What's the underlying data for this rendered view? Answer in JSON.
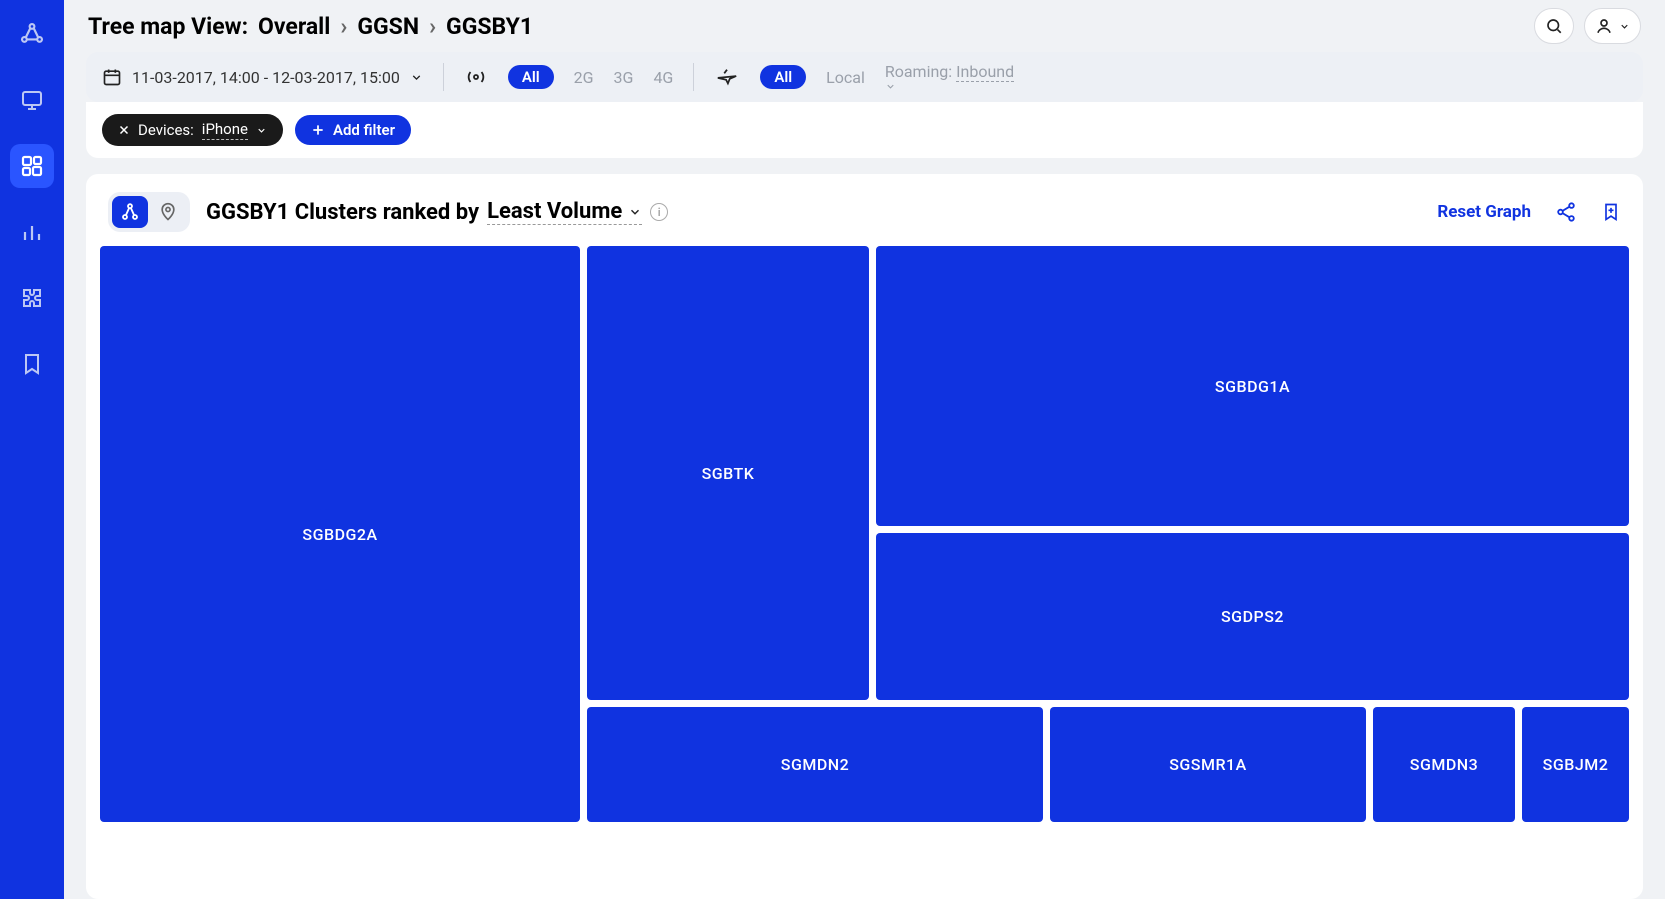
{
  "breadcrumb": {
    "prefix": "Tree map View:",
    "level0": "Overall",
    "level1": "GGSN",
    "level2": "GGSBY1"
  },
  "filters": {
    "date_range": "11-03-2017, 14:00 - 12-03-2017, 15:00",
    "radio": {
      "all": "All",
      "g2": "2G",
      "g3": "3G",
      "g4": "4G"
    },
    "roaming": {
      "all": "All",
      "local": "Local",
      "roaming_label": "Roaming:",
      "roaming_value": "Inbound"
    },
    "device_chip_label": "Devices:",
    "device_chip_value": "iPhone",
    "add_filter": "Add filter"
  },
  "card": {
    "title_prefix": "GGSBY1 Clusters ranked by",
    "rank_metric": "Least Volume",
    "reset": "Reset Graph"
  },
  "chart_data": {
    "type": "treemap",
    "title": "GGSBY1 Clusters ranked by Least Volume",
    "items": [
      {
        "name": "SGBDG2A",
        "value": 29
      },
      {
        "name": "SGBTK",
        "value": 14
      },
      {
        "name": "SGBDG1A",
        "value": 21
      },
      {
        "name": "SGDPS2",
        "value": 13
      },
      {
        "name": "SGMDN2",
        "value": 6
      },
      {
        "name": "SGSMR1A",
        "value": 4
      },
      {
        "name": "SGMDN3",
        "value": 2
      },
      {
        "name": "SGBJM2",
        "value": 1.5
      }
    ],
    "value_unit": "relative_area"
  }
}
